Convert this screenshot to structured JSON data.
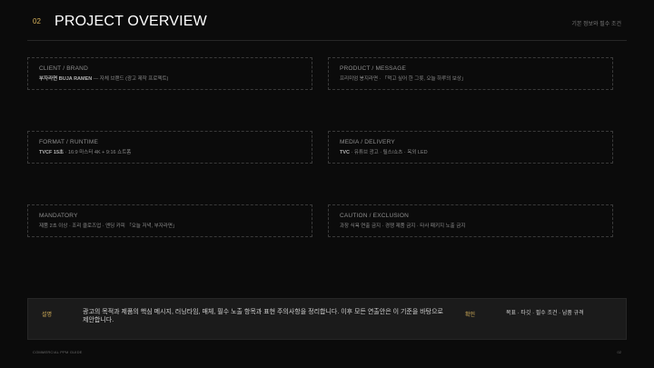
{
  "header": {
    "number": "02",
    "title": "PROJECT OVERVIEW",
    "subtitle": "기본 정보와 필수 조건"
  },
  "cards": [
    {
      "label": "CLIENT / BRAND",
      "value_bold": "부자라면 BUJA RAMEN",
      "value_rest": " — 자체 브랜드 (광고 제작 프로젝트)"
    },
    {
      "label": "PRODUCT / MESSAGE",
      "value_bold": "",
      "value_rest": "프리미엄 봉지라면 · 「먹고 싶어 한 그릇, 오늘 하루의 보상」"
    },
    {
      "label": "FORMAT / RUNTIME",
      "value_bold": "TVCF 15초",
      "value_rest": " · 16:9 마스터 4K + 9:16 쇼트폼"
    },
    {
      "label": "MEDIA / DELIVERY",
      "value_bold": "TVC",
      "value_rest": " · 유튜브 광고 · 릴스/쇼츠 · 옥외 LED"
    },
    {
      "label": "MANDATORY",
      "value_bold": "",
      "value_rest": "제품 2초 이상 · 조리 클로즈업 · 엔딩 카피 「오늘 저녁, 부자라면」"
    },
    {
      "label": "CAUTION / EXCLUSION",
      "value_bold": "",
      "value_rest": "과장 식욕 연출 금지 · 경쟁 제품 금지 · 타사 패키지 노출 금지"
    }
  ],
  "info": {
    "left_tag": "설명",
    "text": "광고의 목적과 제품의 핵심 메시지, 러닝타임, 매체, 필수 노출 항목과 표현 주의사항을 정리합니다. 이후 모든 연출안은 이 기준을 바탕으로 제안합니다.",
    "right_tag": "확인",
    "right_text": "목표 · 타깃 · 필수 조건 · 납품 규격"
  },
  "footer": {
    "left": "COMMERCIAL PPM GUIDE",
    "right": "02"
  },
  "colors": {
    "accent": "#d8b25a",
    "background": "#0b0b0b",
    "panel": "#1b1b1b",
    "border": "#3a3a3a"
  }
}
